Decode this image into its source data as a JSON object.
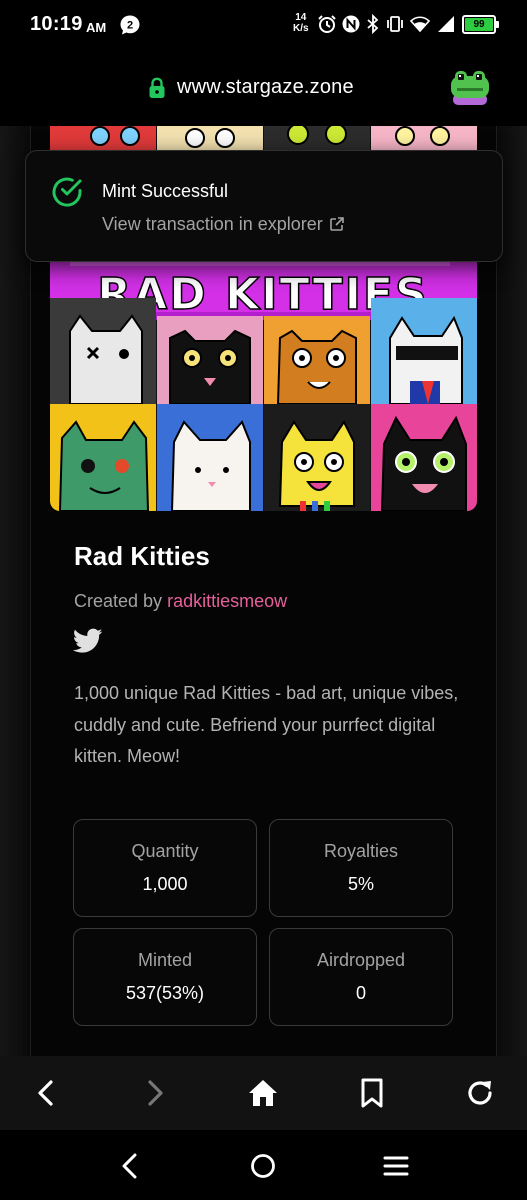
{
  "status_bar": {
    "time": "10:19",
    "ampm": "AM",
    "notification_count": "2",
    "net_speed_value": "14",
    "net_speed_unit": "K/s",
    "battery": "99",
    "icons": [
      "alarm-icon",
      "nfc-icon",
      "bluetooth-icon",
      "vibrate-icon",
      "wifi-icon",
      "signal-icon",
      "battery-icon"
    ]
  },
  "url_bar": {
    "url": "www.stargaze.zone",
    "icon": "lock-icon",
    "app_icon": "stargaze-frog-icon"
  },
  "toast": {
    "title": "Mint Successful",
    "subtitle": "View transaction in explorer",
    "icon": "check-circle-icon",
    "link_icon": "external-link-icon",
    "accent": "#22c55e"
  },
  "banner": {
    "text": "RAD KITTIES",
    "accent": "#e040fb"
  },
  "collection": {
    "title": "Rad Kitties",
    "created_by_label": "Created by",
    "creator": "radkittiesmeow",
    "creator_color": "#e5609c",
    "social_icon": "twitter-icon",
    "description": "1,000 unique Rad Kitties - bad art, unique vibes, cuddly and cute. Befriend your purrfect digital kitten. Meow!"
  },
  "stats": [
    {
      "label": "Quantity",
      "value": "1,000"
    },
    {
      "label": "Royalties",
      "value": "5%"
    },
    {
      "label": "Minted",
      "value": "537(53%)"
    },
    {
      "label": "Airdropped",
      "value": "0"
    }
  ],
  "browser_nav": [
    "back-icon",
    "forward-icon",
    "home-icon",
    "bookmark-icon",
    "reload-icon"
  ],
  "system_nav": [
    "system-back-icon",
    "system-home-icon",
    "system-recents-icon"
  ]
}
